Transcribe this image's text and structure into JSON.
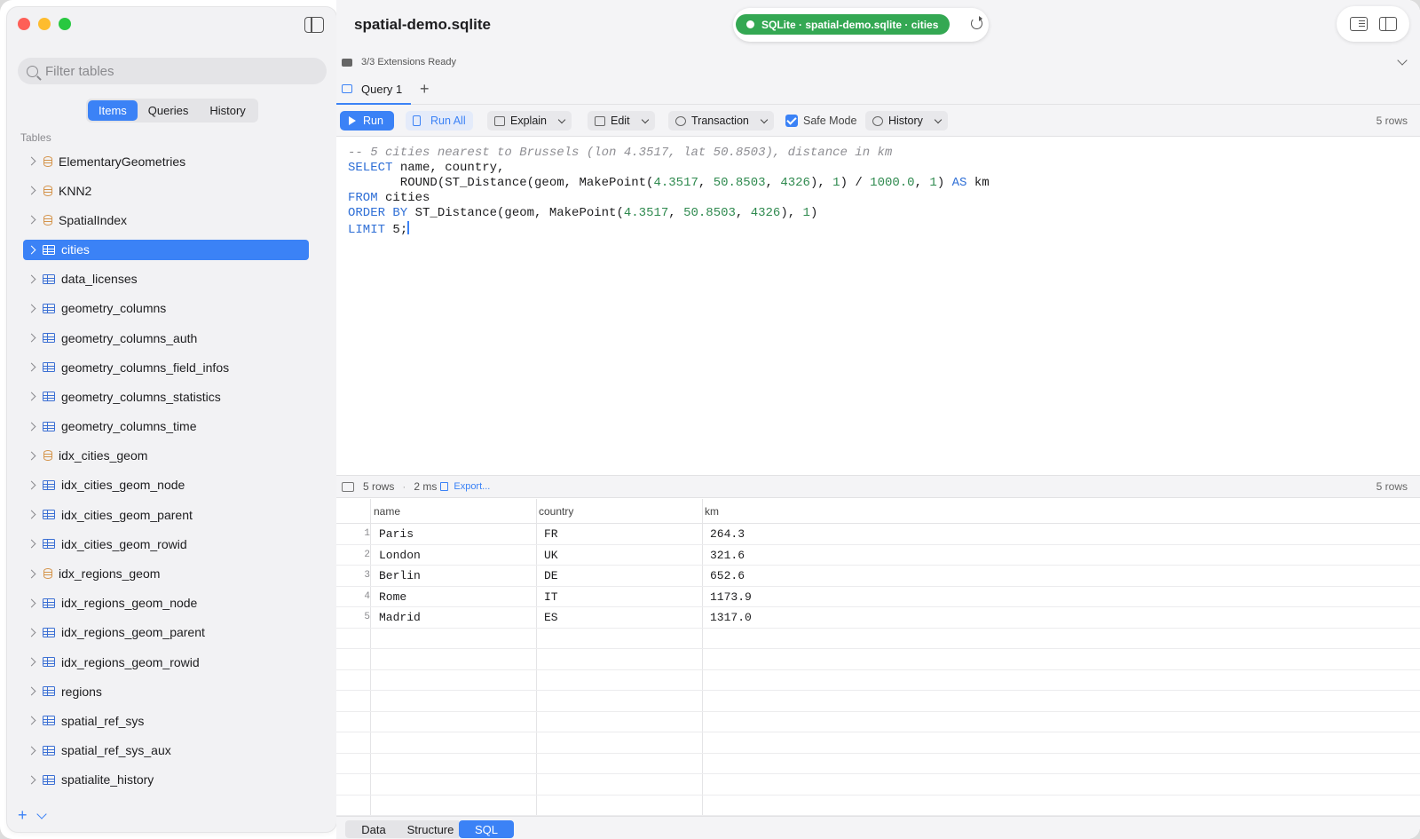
{
  "window": {
    "title": "spatial-demo.sqlite"
  },
  "connection": {
    "label": "SQLite · spatial-demo.sqlite · cities",
    "status_color": "#34a853"
  },
  "extensions": {
    "status": "3/3 Extensions Ready"
  },
  "sidebar": {
    "filter_placeholder": "Filter tables",
    "segments": [
      "Items",
      "Queries",
      "History"
    ],
    "active_segment": "Items",
    "section_label": "Tables",
    "items": [
      {
        "label": "ElementaryGeometries",
        "icon": "database-icon"
      },
      {
        "label": "KNN2",
        "icon": "database-icon"
      },
      {
        "label": "SpatialIndex",
        "icon": "database-icon"
      },
      {
        "label": "cities",
        "icon": "table-icon",
        "selected": true
      },
      {
        "label": "data_licenses",
        "icon": "table-icon"
      },
      {
        "label": "geometry_columns",
        "icon": "table-icon"
      },
      {
        "label": "geometry_columns_auth",
        "icon": "table-icon"
      },
      {
        "label": "geometry_columns_field_infos",
        "icon": "table-icon"
      },
      {
        "label": "geometry_columns_statistics",
        "icon": "table-icon"
      },
      {
        "label": "geometry_columns_time",
        "icon": "table-icon"
      },
      {
        "label": "idx_cities_geom",
        "icon": "database-icon"
      },
      {
        "label": "idx_cities_geom_node",
        "icon": "table-icon"
      },
      {
        "label": "idx_cities_geom_parent",
        "icon": "table-icon"
      },
      {
        "label": "idx_cities_geom_rowid",
        "icon": "table-icon"
      },
      {
        "label": "idx_regions_geom",
        "icon": "database-icon"
      },
      {
        "label": "idx_regions_geom_node",
        "icon": "table-icon"
      },
      {
        "label": "idx_regions_geom_parent",
        "icon": "table-icon"
      },
      {
        "label": "idx_regions_geom_rowid",
        "icon": "table-icon"
      },
      {
        "label": "regions",
        "icon": "table-icon"
      },
      {
        "label": "spatial_ref_sys",
        "icon": "table-icon"
      },
      {
        "label": "spatial_ref_sys_aux",
        "icon": "table-icon"
      },
      {
        "label": "spatialite_history",
        "icon": "table-icon"
      }
    ],
    "add_label": "+"
  },
  "tabs": {
    "query_tab": "Query 1",
    "add": "+"
  },
  "toolbar": {
    "run": "Run",
    "run_all": "Run All",
    "explain": "Explain",
    "edit": "Edit",
    "transaction": "Transaction",
    "safe_mode": "Safe Mode",
    "history": "History",
    "row_count": "5 rows"
  },
  "editor": {
    "comment": "-- 5 cities nearest to Brussels (lon 4.3517, lat 50.8503), distance in km",
    "kw_select": "SELECT",
    "line1_rest": " name, country,",
    "line2_a": "       ROUND(ST_Distance(geom, MakePoint(",
    "n_lon": "4.3517",
    "c1": ", ",
    "n_lat": "50.8503",
    "c2": ", ",
    "n_srid": "4326",
    "line2_b": "), ",
    "n_one": "1",
    "line2_c": ") / ",
    "n_thousand": "1000.0",
    "c3": ", ",
    "n_one2": "1",
    "line2_d": ") ",
    "kw_as": "AS",
    "line2_e": " km",
    "kw_from": "FROM",
    "line3_rest": " cities",
    "kw_order": "ORDER BY",
    "line4_a": " ST_Distance(geom, MakePoint(",
    "line4_b": "), ",
    "line4_c": ")",
    "kw_limit": "LIMIT",
    "line5_rest": " 5;"
  },
  "results": {
    "row_count": "5 rows",
    "time": "2 ms",
    "export": "Export...",
    "row_count_right": "5 rows",
    "columns": [
      "name",
      "country",
      "km"
    ],
    "rows": [
      {
        "n": "1",
        "name": "Paris",
        "country": "FR",
        "km": "264.3"
      },
      {
        "n": "2",
        "name": "London",
        "country": "UK",
        "km": "321.6"
      },
      {
        "n": "3",
        "name": "Berlin",
        "country": "DE",
        "km": "652.6"
      },
      {
        "n": "4",
        "name": "Rome",
        "country": "IT",
        "km": "1173.9"
      },
      {
        "n": "5",
        "name": "Madrid",
        "country": "ES",
        "km": "1317.0"
      }
    ]
  },
  "bottom_tabs": [
    "Data",
    "Structure",
    "SQL"
  ],
  "active_bottom_tab": "SQL"
}
